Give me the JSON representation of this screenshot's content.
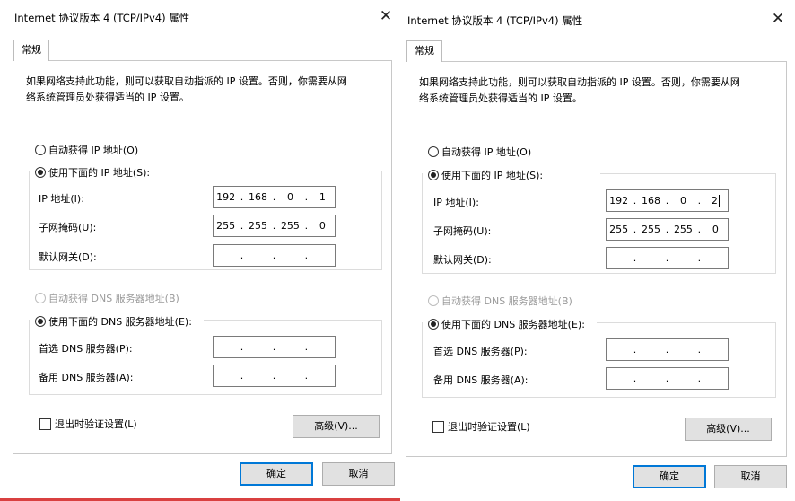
{
  "dialogs": [
    {
      "title": "Internet 协议版本 4 (TCP/IPv4) 属性",
      "close_glyph": "✕",
      "tab_label": "常规",
      "description_line1": "如果网络支持此功能，则可以获取自动指派的 IP 设置。否则，你需要从网",
      "description_line2": "络系统管理员处获得适当的 IP 设置。",
      "auto_ip_label": "自动获得 IP 地址(O)",
      "manual_ip_label": "使用下面的 IP 地址(S):",
      "ip_address_label": "IP 地址(I):",
      "ip_address": [
        "192",
        "168",
        "0",
        "1"
      ],
      "subnet_label": "子网掩码(U):",
      "subnet_mask": [
        "255",
        "255",
        "255",
        "0"
      ],
      "gateway_label": "默认网关(D):",
      "gateway": [
        "",
        "",
        "",
        ""
      ],
      "auto_dns_label": "自动获得 DNS 服务器地址(B)",
      "manual_dns_label": "使用下面的 DNS 服务器地址(E):",
      "preferred_dns_label": "首选 DNS 服务器(P):",
      "preferred_dns": [
        "",
        "",
        "",
        ""
      ],
      "alternate_dns_label": "备用 DNS 服务器(A):",
      "alternate_dns": [
        "",
        "",
        "",
        ""
      ],
      "validate_label": "退出时验证设置(L)",
      "advanced_label": "高级(V)...",
      "ok_label": "确定",
      "cancel_label": "取消"
    },
    {
      "title": "Internet 协议版本 4 (TCP/IPv4) 属性",
      "close_glyph": "✕",
      "tab_label": "常规",
      "description_line1": "如果网络支持此功能，则可以获取自动指派的 IP 设置。否则，你需要从网",
      "description_line2": "络系统管理员处获得适当的 IP 设置。",
      "auto_ip_label": "自动获得 IP 地址(O)",
      "manual_ip_label": "使用下面的 IP 地址(S):",
      "ip_address_label": "IP 地址(I):",
      "ip_address": [
        "192",
        "168",
        "0",
        "2"
      ],
      "subnet_label": "子网掩码(U):",
      "subnet_mask": [
        "255",
        "255",
        "255",
        "0"
      ],
      "gateway_label": "默认网关(D):",
      "gateway": [
        "",
        "",
        "",
        ""
      ],
      "auto_dns_label": "自动获得 DNS 服务器地址(B)",
      "manual_dns_label": "使用下面的 DNS 服务器地址(E):",
      "preferred_dns_label": "首选 DNS 服务器(P):",
      "preferred_dns": [
        "",
        "",
        "",
        ""
      ],
      "alternate_dns_label": "备用 DNS 服务器(A):",
      "alternate_dns": [
        "",
        "",
        "",
        ""
      ],
      "validate_label": "退出时验证设置(L)",
      "advanced_label": "高级(V)...",
      "ok_label": "确定",
      "cancel_label": "取消"
    }
  ],
  "colors": {
    "primary_button_border": "#0078d7",
    "button_face": "#e1e1e1",
    "bottom_accent": "#d94040"
  }
}
